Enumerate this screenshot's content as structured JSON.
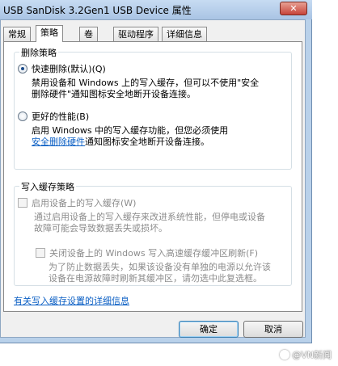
{
  "window": {
    "title": "USB  SanDisk 3.2Gen1 USB Device 属性",
    "close_label": "✕"
  },
  "tabs": [
    {
      "label": "常规"
    },
    {
      "label": "策略"
    },
    {
      "label": "卷"
    },
    {
      "label": "驱动程序"
    },
    {
      "label": "详细信息"
    }
  ],
  "active_tab": "策略",
  "removal_policy": {
    "title": "删除策略",
    "quick_removal": {
      "label": "快速删除(默认)(Q)",
      "desc_line1": "禁用设备和 Windows 上的写入缓存，但可以不使用\"安全",
      "desc_line2": "删除硬件\"通知图标安全地断开设备连接。",
      "checked": true
    },
    "better_performance": {
      "label": "更好的性能(B)",
      "desc_line1": "启用 Windows 中的写入缓存功能，但您必须使用",
      "desc_link": "安全删除硬件",
      "desc_line2_rest": "通知图标安全地断开设备连接。",
      "checked": false
    }
  },
  "write_cache_policy": {
    "title": "写入缓存策略",
    "enable_cache": {
      "label": "启用设备上的写入缓存(W)",
      "desc_line1": "通过启用设备上的写入缓存来改进系统性能，但停电或设备",
      "desc_line2": "故障可能会导致数据丢失或损坏。",
      "checked": false
    },
    "disable_flush": {
      "label": "关闭设备上的 Windows 写入高速缓存缓冲区刷新(F)",
      "desc_line1": "为了防止数据丢失，如果该设备没有单独的电源以允许该",
      "desc_line2": "设备在电源故障时刷新其缓冲区，请勿选中此复选框。",
      "checked": false
    }
  },
  "details_link": "有关写入缓存设置的详细信息",
  "buttons": {
    "ok": "确定",
    "cancel": "取消"
  },
  "watermark": "@VN新闻"
}
